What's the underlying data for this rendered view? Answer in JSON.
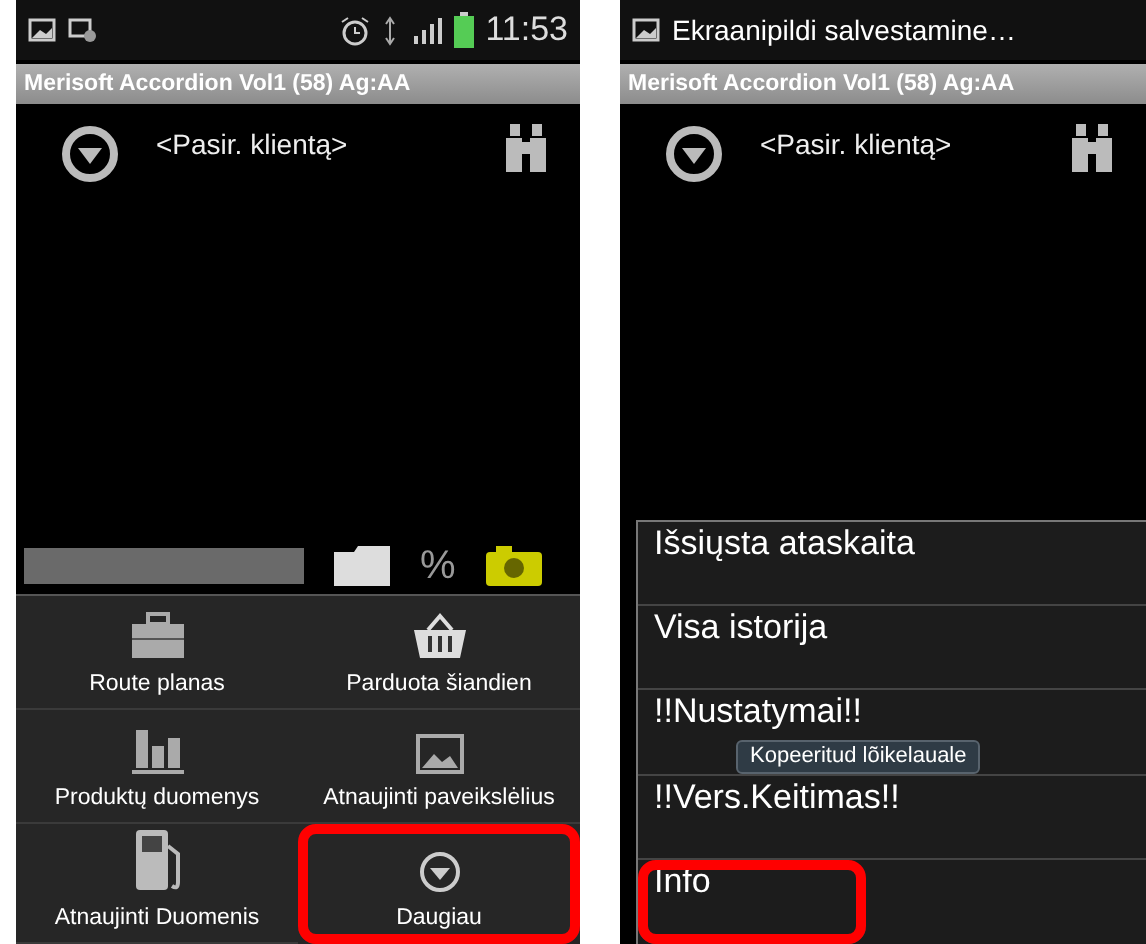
{
  "screens": [
    {
      "status_bar": {
        "time": "11:53"
      },
      "title_bar": "Merisoft Accordion Vol1 (58) Ag:AA",
      "client_selector": "<Pasir. klientą>",
      "behind_icons": {
        "percent": "%"
      },
      "menu": {
        "kind": "grid",
        "items": [
          {
            "label": "Route planas",
            "highlighted": false
          },
          {
            "label": "Parduota šiandien",
            "highlighted": false
          },
          {
            "label": "Produktų duomenys",
            "highlighted": false
          },
          {
            "label": "Atnaujinti paveikslėlius",
            "highlighted": false
          },
          {
            "label": "Atnaujinti Duomenis",
            "highlighted": false
          },
          {
            "label": "Daugiau",
            "highlighted": true
          }
        ]
      }
    },
    {
      "status_bar": {
        "notification": "Ekraanipildi salvestamine…"
      },
      "title_bar": "Merisoft Accordion Vol1 (58) Ag:AA",
      "client_selector": "<Pasir. klientą>",
      "menu": {
        "kind": "list",
        "items": [
          {
            "label": "Išsiųsta ataskaita",
            "highlighted": false
          },
          {
            "label": "Visa istorija",
            "highlighted": false
          },
          {
            "label": "!!Nustatymai!!",
            "highlighted": false
          },
          {
            "label": "!!Vers.Keitimas!!",
            "highlighted": false
          },
          {
            "label": "Info",
            "highlighted": true
          }
        ]
      },
      "toast": "Kopeeritud lõikelauale"
    }
  ]
}
